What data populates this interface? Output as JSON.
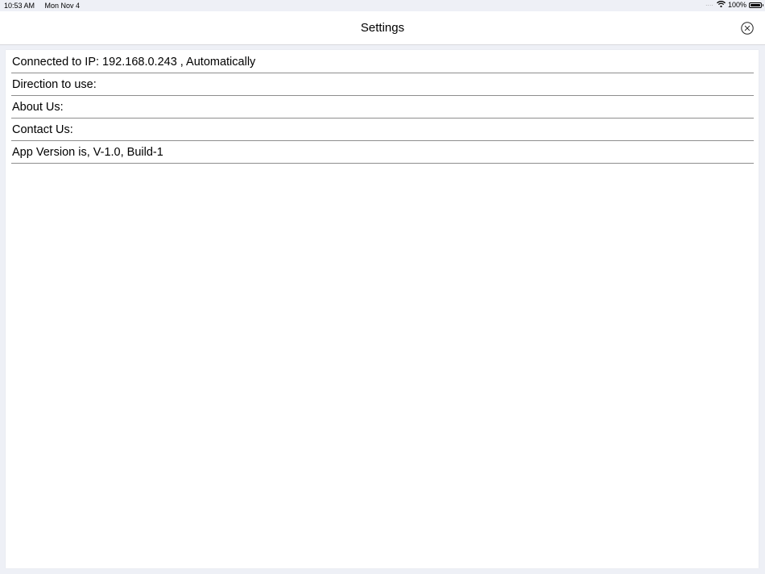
{
  "status_bar": {
    "time": "10:53 AM",
    "date": "Mon Nov 4",
    "signal": "....",
    "battery_percent": "100%",
    "battery_level": 1.0,
    "wifi_icon": "wifi-icon",
    "battery_icon": "battery-icon"
  },
  "nav": {
    "title": "Settings",
    "close_icon": "close-circle-icon"
  },
  "settings": {
    "items": [
      {
        "label": "Connected to IP: 192.168.0.243 , Automatically"
      },
      {
        "label": "Direction to use:"
      },
      {
        "label": "About Us:"
      },
      {
        "label": "Contact Us:"
      },
      {
        "label": "App Version is, V-1.0, Build-1"
      }
    ]
  },
  "colors": {
    "background": "#eef0f6",
    "surface": "#ffffff",
    "separator": "#8e8e8e"
  }
}
